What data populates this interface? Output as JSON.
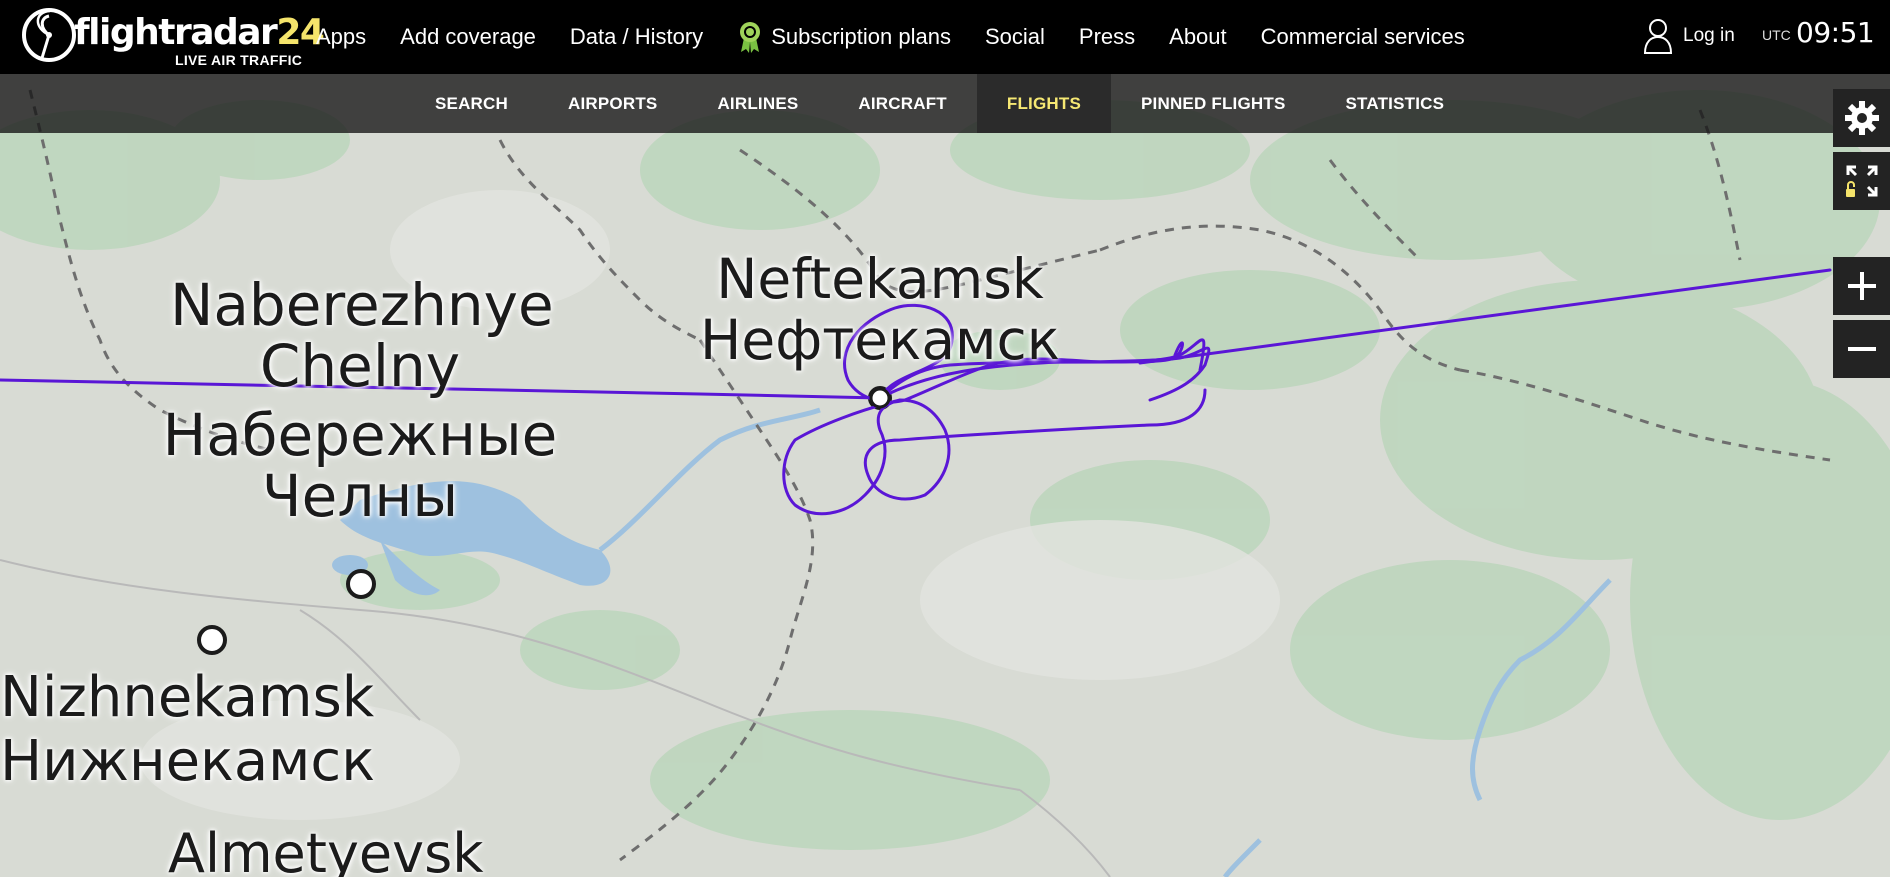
{
  "brand": {
    "name_main": "flightradar",
    "name_num": "24",
    "tagline": "LIVE AIR TRAFFIC"
  },
  "nav": {
    "items": [
      "Apps",
      "Add coverage",
      "Data / History",
      "Subscription plans",
      "Social",
      "Press",
      "About",
      "Commercial services"
    ],
    "login": "Log in",
    "utc_label": "UTC",
    "time": "09:51"
  },
  "subnav": {
    "items": [
      "SEARCH",
      "AIRPORTS",
      "AIRLINES",
      "AIRCRAFT",
      "FLIGHTS",
      "PINNED FLIGHTS",
      "STATISTICS"
    ],
    "active": "FLIGHTS"
  },
  "map": {
    "cities": [
      {
        "name_en": "Naberezhnye Chelny",
        "name_ru": "Набережные Челны"
      },
      {
        "name_en": "Neftekamsk",
        "name_ru": "Нефтекамск"
      },
      {
        "name_en": "Nizhnekamsk",
        "name_ru": "Нижнекамск"
      },
      {
        "name_en": "Almetyevsk"
      }
    ],
    "track_color": "#5a16d6"
  },
  "controls": {
    "settings": "gear-icon",
    "fullscreen": "fullscreen-icon",
    "zoom_in": "+",
    "zoom_out": "−"
  },
  "colors": {
    "active_tab": "#f6e873",
    "brand_accent": "#f5e46b"
  }
}
